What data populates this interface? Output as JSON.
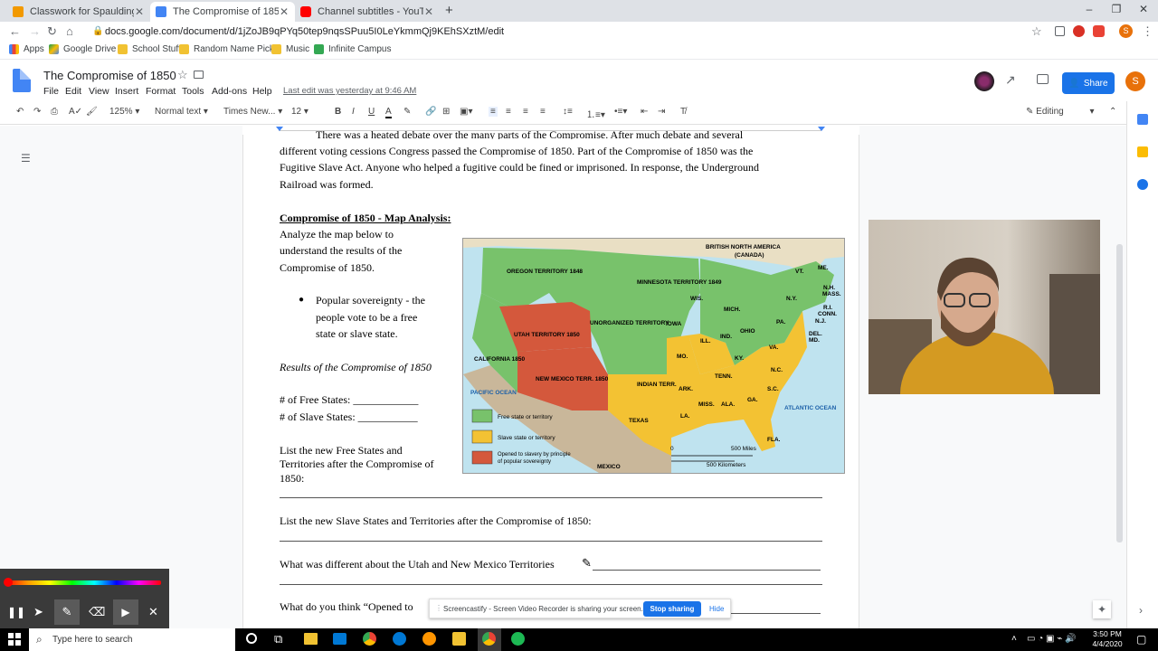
{
  "browser": {
    "tabs": [
      {
        "title": "Classwork for Spaulding 8th Grad",
        "color": "#f29900",
        "active": false
      },
      {
        "title": "The Compromise of 1850 - Goog",
        "color": "#4285f4",
        "active": true
      },
      {
        "title": "Channel subtitles - YouTube Stu",
        "color": "#ff0000",
        "active": false
      }
    ],
    "new_tab": "+",
    "url": "docs.google.com/document/d/1jZoJB9qPYq50tep9nqsSPuu5I0LeYkmmQj9KEhSXztM/edit",
    "bookmarks": [
      "Apps",
      "Google Drive",
      "School Stuff",
      "Random Name Pick...",
      "Music",
      "Infinite Campus"
    ],
    "profile_initial": "S"
  },
  "doc": {
    "title": "The Compromise of 1850",
    "menus": [
      "File",
      "Edit",
      "View",
      "Insert",
      "Format",
      "Tools",
      "Add-ons",
      "Help"
    ],
    "last_edit": "Last edit was yesterday at 9:46 AM",
    "share_label": "Share",
    "user_initial": "S",
    "editing_label": "Editing"
  },
  "toolbar": {
    "zoom": "125%",
    "style": "Normal text",
    "font": "Times New...",
    "size": "12"
  },
  "body": {
    "para1_line1": "There was a heated debate over the many parts of the Compromise. After much debate and several",
    "para1_line2": "different voting cessions Congress passed the Compromise of 1850. Part of the Compromise of 1850 was the",
    "para1_line3": "Fugitive Slave Act. Anyone who helped a fugitive could be fined or imprisoned. In response, the Underground",
    "para1_line4": "Railroad was formed.",
    "heading": "Compromise of 1850 - Map Analysis:",
    "analyze_1": "Analyze the map below to",
    "analyze_2": "understand the results of the",
    "analyze_3": "Compromise of 1850.",
    "bullet_1": "Popular sovereignty - the",
    "bullet_2": "people vote to be a free",
    "bullet_3": "state or slave state.",
    "results": "Results of the Compromise of 1850",
    "free_states": "# of Free States: ____________",
    "slave_states": "# of Slave States: ___________",
    "list_free_1": "List the new Free States and",
    "list_free_2": "Territories after the Compromise of",
    "list_free_3": "1850:",
    "list_slave": "List the new Slave States and Territories after the Compromise of 1850:",
    "q_different": "What was different about the Utah and New Mexico Territories",
    "q_opened": "What do you think “Opened to"
  },
  "map": {
    "labels": {
      "bna": "BRITISH NORTH AMERICA",
      "canada": "(CANADA)",
      "oregon": "OREGON TERRITORY 1848",
      "minnesota": "MINNESOTA TERRITORY 1849",
      "unorganized": "UNORGANIZED TERRITORY",
      "utah": "UTAH TERRITORY 1850",
      "newmexico": "NEW MEXICO TERR. 1850",
      "california": "CALIFORNIA 1850",
      "texas": "TEXAS",
      "indian": "INDIAN TERR.",
      "mexico": "MEXICO",
      "pacific": "PACIFIC OCEAN",
      "atlantic": "ATLANTIC OCEAN",
      "iowa": "IOWA",
      "wis": "WIS.",
      "mich": "MICH.",
      "ill": "ILL.",
      "ind": "IND.",
      "ohio": "OHIO",
      "pa": "PA.",
      "ny": "N.Y.",
      "mo": "MO.",
      "ky": "KY.",
      "va": "VA.",
      "tenn": "TENN.",
      "nc": "N.C.",
      "sc": "S.C.",
      "ark": "ARK.",
      "miss": "MISS.",
      "ala": "ALA.",
      "ga": "GA.",
      "la": "LA.",
      "fla": "FLA.",
      "me": "ME.",
      "vt": "VT.",
      "nh": "N.H.",
      "mass": "MASS.",
      "ri": "R.I.",
      "conn": "CONN.",
      "nj": "N.J.",
      "del": "DEL.",
      "md": "MD.",
      "scale_mi": "500 Miles",
      "scale_km": "500 Kilometers",
      "scale_zero": "0"
    },
    "legend": [
      {
        "label": "Free state or territory",
        "color": "#6dbf5b"
      },
      {
        "label": "Slave state or territory",
        "color": "#f3c233"
      },
      {
        "label": "Opened to slavery by principle of popular sovereignty",
        "color": "#d4583c"
      }
    ],
    "colors": {
      "free": "#78c26b",
      "slave": "#f3c233",
      "popular": "#d4583c",
      "land": "#c9b79a",
      "water": "#bfe3ef"
    }
  },
  "overlay": {
    "share_text": "Screencastify - Screen Video Recorder is sharing your screen.",
    "stop_label": "Stop sharing",
    "hide_label": "Hide"
  },
  "taskbar": {
    "search_placeholder": "Type here to search",
    "time": "3:50 PM",
    "date": "4/4/2020"
  }
}
